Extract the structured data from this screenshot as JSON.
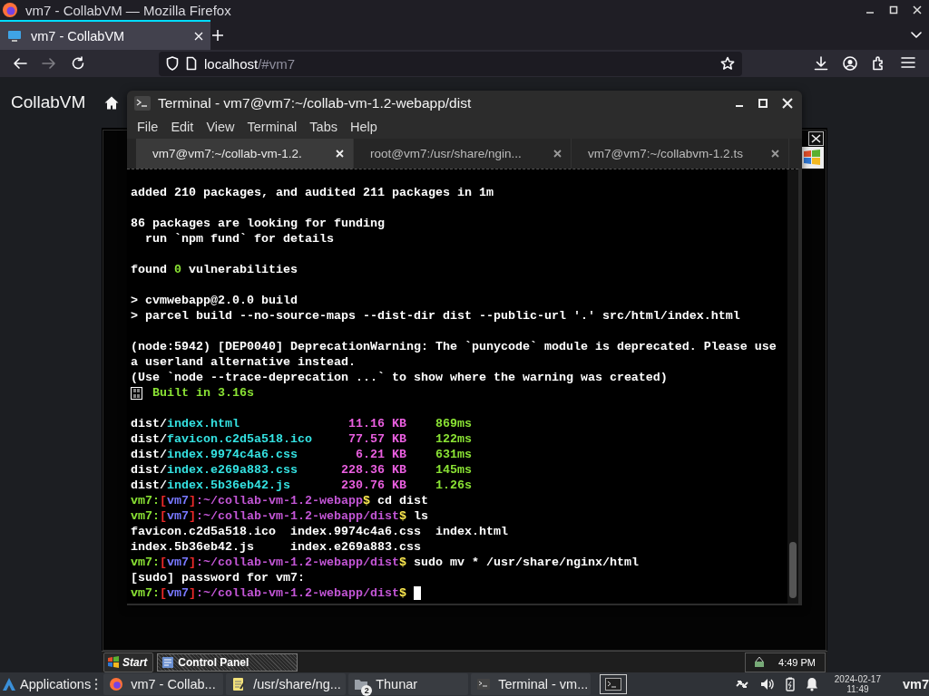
{
  "browser": {
    "window_title": "vm7 - CollabVM — Mozilla Firefox",
    "tabs": [
      {
        "label": "vm7 - CollabVM",
        "selected": true
      }
    ],
    "navigation": {
      "forward_disabled": true
    },
    "url": {
      "host": "localhost",
      "path": "/#vm7"
    }
  },
  "page": {
    "brand": "CollabVM"
  },
  "vm": {
    "taskbar": {
      "start": "Start",
      "tasks": [
        {
          "label": "Control Panel",
          "selected": true
        }
      ],
      "clock": "4:49 PM"
    }
  },
  "terminal": {
    "title": "Terminal - vm7@vm7:~/collab-vm-1.2-webapp/dist",
    "menu": [
      "File",
      "Edit",
      "View",
      "Terminal",
      "Tabs",
      "Help"
    ],
    "tabs": [
      {
        "label": "vm7@vm7:~/collab-vm-1.2.",
        "selected": true
      },
      {
        "label": "root@vm7:/usr/share/ngin...",
        "selected": false
      },
      {
        "label": "vm7@vm7:~/collabvm-1.2.ts",
        "selected": false
      }
    ],
    "lines": [
      {
        "kind": "text",
        "cursor": false,
        "segments": [
          {
            "kind": "plain",
            "text": "added 210 packages, and audited 211 packages in 1m"
          }
        ]
      },
      {
        "kind": "blank"
      },
      {
        "kind": "text",
        "cursor": false,
        "segments": [
          {
            "kind": "plain",
            "text": "86 packages are looking for funding"
          }
        ]
      },
      {
        "kind": "text",
        "cursor": false,
        "segments": [
          {
            "kind": "plain",
            "text": "  run `npm fund` for details"
          }
        ]
      },
      {
        "kind": "blank"
      },
      {
        "kind": "text",
        "cursor": false,
        "segments": [
          {
            "kind": "plain",
            "text": "found "
          },
          {
            "kind": "success",
            "text": "0"
          },
          {
            "kind": "plain",
            "text": " vulnerabilities"
          }
        ]
      },
      {
        "kind": "blank"
      },
      {
        "kind": "text",
        "cursor": false,
        "segments": [
          {
            "kind": "plain",
            "text": "> cvmwebapp@2.0.0 build"
          }
        ]
      },
      {
        "kind": "text",
        "cursor": false,
        "segments": [
          {
            "kind": "plain",
            "text": "> parcel build --no-source-maps --dist-dir dist --public-url '.' src/html/index.html"
          }
        ]
      },
      {
        "kind": "blank"
      },
      {
        "kind": "text",
        "cursor": false,
        "segments": [
          {
            "kind": "plain",
            "text": "(node:5942) [DEP0040] DeprecationWarning: The `punycode` module is deprecated. Please use"
          }
        ]
      },
      {
        "kind": "text",
        "cursor": false,
        "segments": [
          {
            "kind": "plain",
            "text": "a userland alternative instead."
          }
        ]
      },
      {
        "kind": "text",
        "cursor": false,
        "segments": [
          {
            "kind": "plain",
            "text": "(Use `node --trace-deprecation ...` to show where the warning was created)"
          }
        ]
      },
      {
        "kind": "status",
        "segments": [
          {
            "kind": "success",
            "text": "Built in 3.16s"
          }
        ]
      },
      {
        "kind": "blank"
      },
      {
        "kind": "file",
        "dir": "dist/",
        "name": "index.html",
        "size": "11.16 KB",
        "time": "869ms"
      },
      {
        "kind": "file",
        "dir": "dist/",
        "name": "favicon.c2d5a518.ico",
        "size": "77.57 KB",
        "time": "122ms"
      },
      {
        "kind": "file",
        "dir": "dist/",
        "name": "index.9974c4a6.css",
        "size": "6.21 KB",
        "time": "631ms"
      },
      {
        "kind": "file",
        "dir": "dist/",
        "name": "index.e269a883.css",
        "size": "228.36 KB",
        "time": "145ms"
      },
      {
        "kind": "file",
        "dir": "dist/",
        "name": "index.5b36eb42.js",
        "size": "230.76 KB",
        "time": "1.26s"
      },
      {
        "kind": "text",
        "cursor": false,
        "segments": [
          {
            "kind": "user",
            "text": "vm7:"
          },
          {
            "kind": "bracket",
            "text": "["
          },
          {
            "kind": "host",
            "text": "vm7"
          },
          {
            "kind": "bracket",
            "text": "]"
          },
          {
            "kind": "path",
            "text": ":~/collab-vm-1.2-webapp"
          },
          {
            "kind": "sign",
            "text": "$"
          },
          {
            "kind": "plain",
            "text": " cd dist"
          }
        ]
      },
      {
        "kind": "text",
        "cursor": false,
        "segments": [
          {
            "kind": "user",
            "text": "vm7:"
          },
          {
            "kind": "bracket",
            "text": "["
          },
          {
            "kind": "host",
            "text": "vm7"
          },
          {
            "kind": "bracket",
            "text": "]"
          },
          {
            "kind": "path",
            "text": ":~/collab-vm-1.2-webapp/dist"
          },
          {
            "kind": "sign",
            "text": "$"
          },
          {
            "kind": "plain",
            "text": " ls"
          }
        ]
      },
      {
        "kind": "text",
        "cursor": false,
        "segments": [
          {
            "kind": "plain",
            "text": "favicon.c2d5a518.ico  index.9974c4a6.css  index.html"
          }
        ]
      },
      {
        "kind": "text",
        "cursor": false,
        "segments": [
          {
            "kind": "plain",
            "text": "index.5b36eb42.js     index.e269a883.css"
          }
        ]
      },
      {
        "kind": "text",
        "cursor": false,
        "segments": [
          {
            "kind": "user",
            "text": "vm7:"
          },
          {
            "kind": "bracket",
            "text": "["
          },
          {
            "kind": "host",
            "text": "vm7"
          },
          {
            "kind": "bracket",
            "text": "]"
          },
          {
            "kind": "path",
            "text": ":~/collab-vm-1.2-webapp/dist"
          },
          {
            "kind": "sign",
            "text": "$"
          },
          {
            "kind": "plain",
            "text": " sudo mv * /usr/share/nginx/html"
          }
        ]
      },
      {
        "kind": "text",
        "cursor": false,
        "segments": [
          {
            "kind": "plain",
            "text": "[sudo] password for vm7:"
          }
        ]
      },
      {
        "kind": "text",
        "cursor": true,
        "segments": [
          {
            "kind": "user",
            "text": "vm7:"
          },
          {
            "kind": "bracket",
            "text": "["
          },
          {
            "kind": "host",
            "text": "vm7"
          },
          {
            "kind": "bracket",
            "text": "]"
          },
          {
            "kind": "path",
            "text": ":~/collab-vm-1.2-webapp/dist"
          },
          {
            "kind": "sign",
            "text": "$"
          }
        ]
      }
    ]
  },
  "panel": {
    "applications": "Applications",
    "tasks": [
      {
        "kind": "browser",
        "label": "vm7 - Collab..."
      },
      {
        "kind": "editor",
        "label": "/usr/share/ng..."
      },
      {
        "kind": "folder",
        "label": "Thunar",
        "badge": "2"
      },
      {
        "kind": "terminal",
        "label": "Terminal - vm..."
      }
    ],
    "date": "2024-02-17",
    "time": "11:49",
    "user": "vm7"
  }
}
